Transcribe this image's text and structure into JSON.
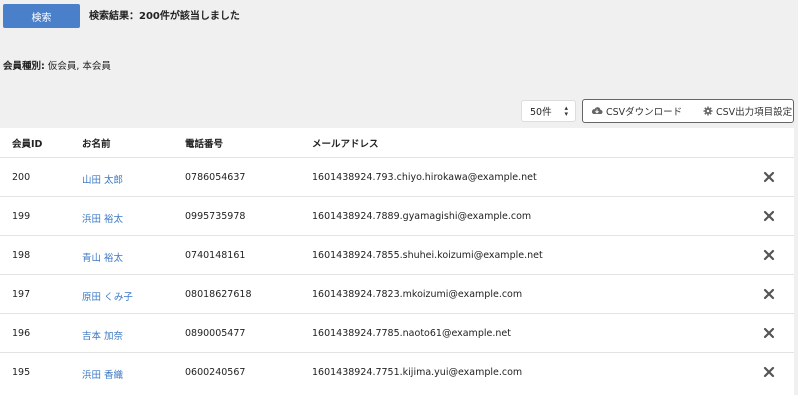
{
  "search": {
    "button_label": "検索",
    "result_text": "検索結果：200件が該当しました"
  },
  "filter": {
    "label": "会員種別:",
    "value": " 仮会員, 本会員"
  },
  "toolbar": {
    "page_size": "50件",
    "csv_download_label": "CSVダウンロード",
    "csv_settings_label": "CSV出力項目設定"
  },
  "table": {
    "headers": {
      "id": "会員ID",
      "name": "お名前",
      "tel": "電話番号",
      "email": "メールアドレス"
    },
    "rows": [
      {
        "id": "200",
        "name": "山田 太郎",
        "tel": "0786054637",
        "email": "1601438924.793.chiyo.hirokawa@example.net"
      },
      {
        "id": "199",
        "name": "浜田 裕太",
        "tel": "0995735978",
        "email": "1601438924.7889.gyamagishi@example.com"
      },
      {
        "id": "198",
        "name": "青山 裕太",
        "tel": "0740148161",
        "email": "1601438924.7855.shuhei.koizumi@example.net"
      },
      {
        "id": "197",
        "name": "原田 くみ子",
        "tel": "08018627618",
        "email": "1601438924.7823.mkoizumi@example.com"
      },
      {
        "id": "196",
        "name": "吉本 加奈",
        "tel": "0890005477",
        "email": "1601438924.7785.naoto61@example.net"
      },
      {
        "id": "195",
        "name": "浜田 香織",
        "tel": "0600240567",
        "email": "1601438924.7751.kijima.yui@example.com"
      }
    ]
  },
  "colors": {
    "primary": "#4a7fca",
    "link": "#3b78c4",
    "background": "#f0f0f0"
  },
  "icons": {
    "download": "cloud-download-icon",
    "settings": "gear-icon",
    "delete": "close-icon",
    "select": "chevron-updown-icon"
  }
}
